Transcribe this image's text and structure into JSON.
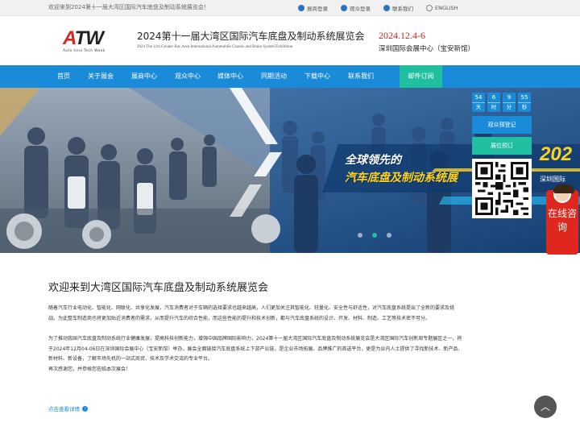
{
  "topbar": {
    "welcome": "欢迎来到2024第十一届大湾区国际汽车底盘及制动系统展览会！",
    "links": [
      {
        "label": "展商登录",
        "icon": "user-icon"
      },
      {
        "label": "观众登录",
        "icon": "user-icon"
      },
      {
        "label": "联系我们",
        "icon": "phone-icon"
      },
      {
        "label": "ENGLISH",
        "icon": "globe-icon"
      }
    ]
  },
  "header": {
    "logo_text": "ATW",
    "logo_sub": "Auto Inno Tech Week",
    "title": "2024第十一届大湾区国际汽车底盘及制动系统展览会",
    "subtitle": "2024 The 11th Greater Bay Area International Automobile Chassis and Brake System Exhibition",
    "date": "2024.12.4-6",
    "venue": "深圳国际会展中心（宝安新馆）"
  },
  "nav": {
    "items": [
      "首页",
      "关于展会",
      "展商中心",
      "观众中心",
      "媒体中心",
      "同期活动",
      "下载中心",
      "联系我们",
      "邮件订阅"
    ]
  },
  "banner": {
    "headline1": "全球领先的",
    "headline2": "汽车底盘及制动系统展",
    "advert_year": "202",
    "advert_city": "深圳国际",
    "slides": 3,
    "active_slide": 2
  },
  "countdown": [
    {
      "value": "54",
      "unit": "天"
    },
    {
      "value": "6",
      "unit": "时"
    },
    {
      "value": "9",
      "unit": "分"
    },
    {
      "value": "55",
      "unit": "秒"
    }
  ],
  "side": {
    "visitor_register": "观众预登记",
    "booth_booking": "展位预订",
    "consult": "在线咨询"
  },
  "content": {
    "title": "欢迎来到大湾区国际汽车底盘及制动系统展览会",
    "p1": "随着汽车行业电动化、智能化、网联化、共享化发展，汽车消费者对于车辆的选择要求也越来越高，人们更加关注其智能化、轻量化、安全性与舒适性，对汽车底盘系统提出了全新的要求及挑战。为此整车制造商也将更加贴近消费者的需求，从而提升汽车的综合性能，而这些性能的提升和技术创新，都与汽车底盘系统的设计、开发、材料、制造、工艺等技术密不可分。",
    "p2": "为了推动我国汽车底盘及制动系统行业健康发展，提高科技创新能力，增强中国品牌国际影响力，2024第十一届大湾区国际汽车底盘及制动系统展览会是大湾区国际汽车创新周专题展区之一，将于2024年12月04-06日在深圳国际会展中心（宝安新馆）举办。展会全面链接汽车底盘系统上下游产业链，是企业市场拓展、品牌推广的首选平台，更是为业内人士提供了寻找新技术、新产品、新材料、新设备，了解市场先机的一站式商贸、技术及学术交流的专业平台。",
    "p3": "再次感谢您，并恭候您莅临本次展会！",
    "more": "点击查看详情"
  },
  "colors": {
    "primary": "#1a8bd8",
    "accent": "#1fbfa0",
    "red": "#c0272d"
  }
}
